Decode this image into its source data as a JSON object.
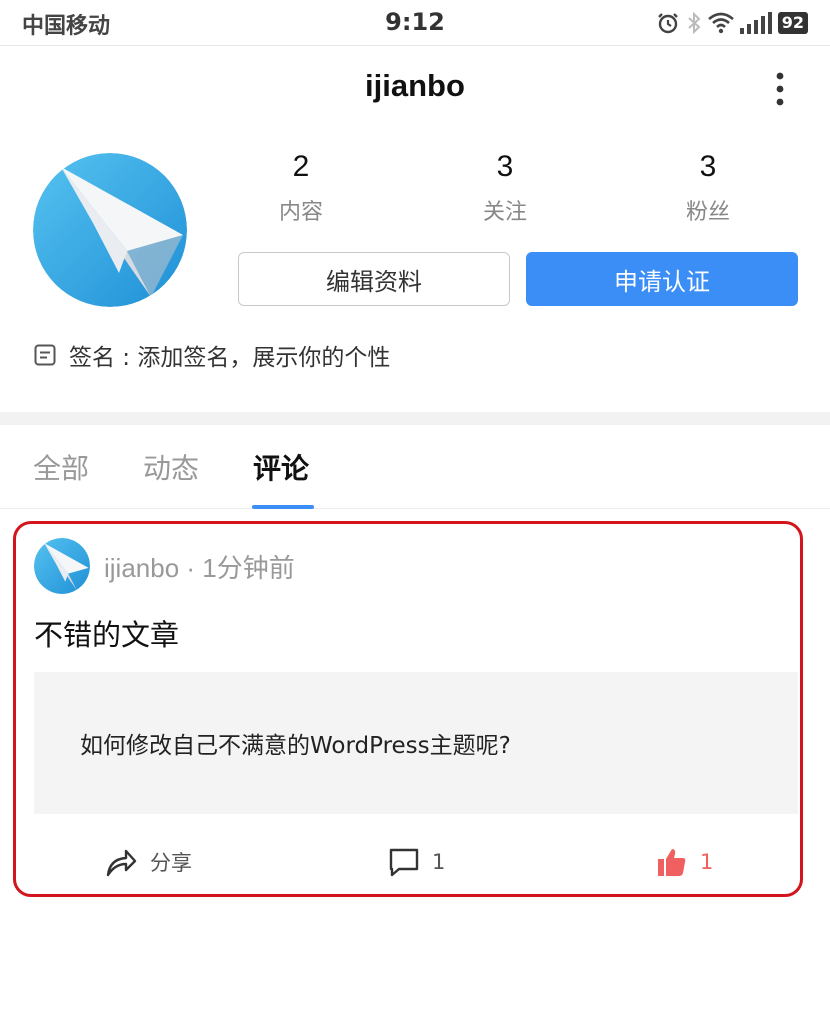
{
  "status_bar": {
    "carrier": "中国移动",
    "time": "9:12",
    "battery": "92"
  },
  "header": {
    "title": "ijianbo"
  },
  "profile": {
    "stats": [
      {
        "value": "2",
        "label": "内容"
      },
      {
        "value": "3",
        "label": "关注"
      },
      {
        "value": "3",
        "label": "粉丝"
      }
    ],
    "edit_button": "编辑资料",
    "verify_button": "申请认证",
    "signature": "签名 : 添加签名，展示你的个性"
  },
  "tabs": [
    {
      "label": "全部"
    },
    {
      "label": "动态"
    },
    {
      "label": "评论"
    }
  ],
  "comment": {
    "meta": "ijianbo · 1分钟前",
    "text": "不错的文章",
    "quoted_title": "如何修改自己不满意的WordPress主题呢?",
    "share_label": "分享",
    "comment_count": "1",
    "like_count": "1"
  },
  "colors": {
    "accent": "#3a8ef6",
    "highlight_border": "#d3141c",
    "like": "#f06060"
  }
}
